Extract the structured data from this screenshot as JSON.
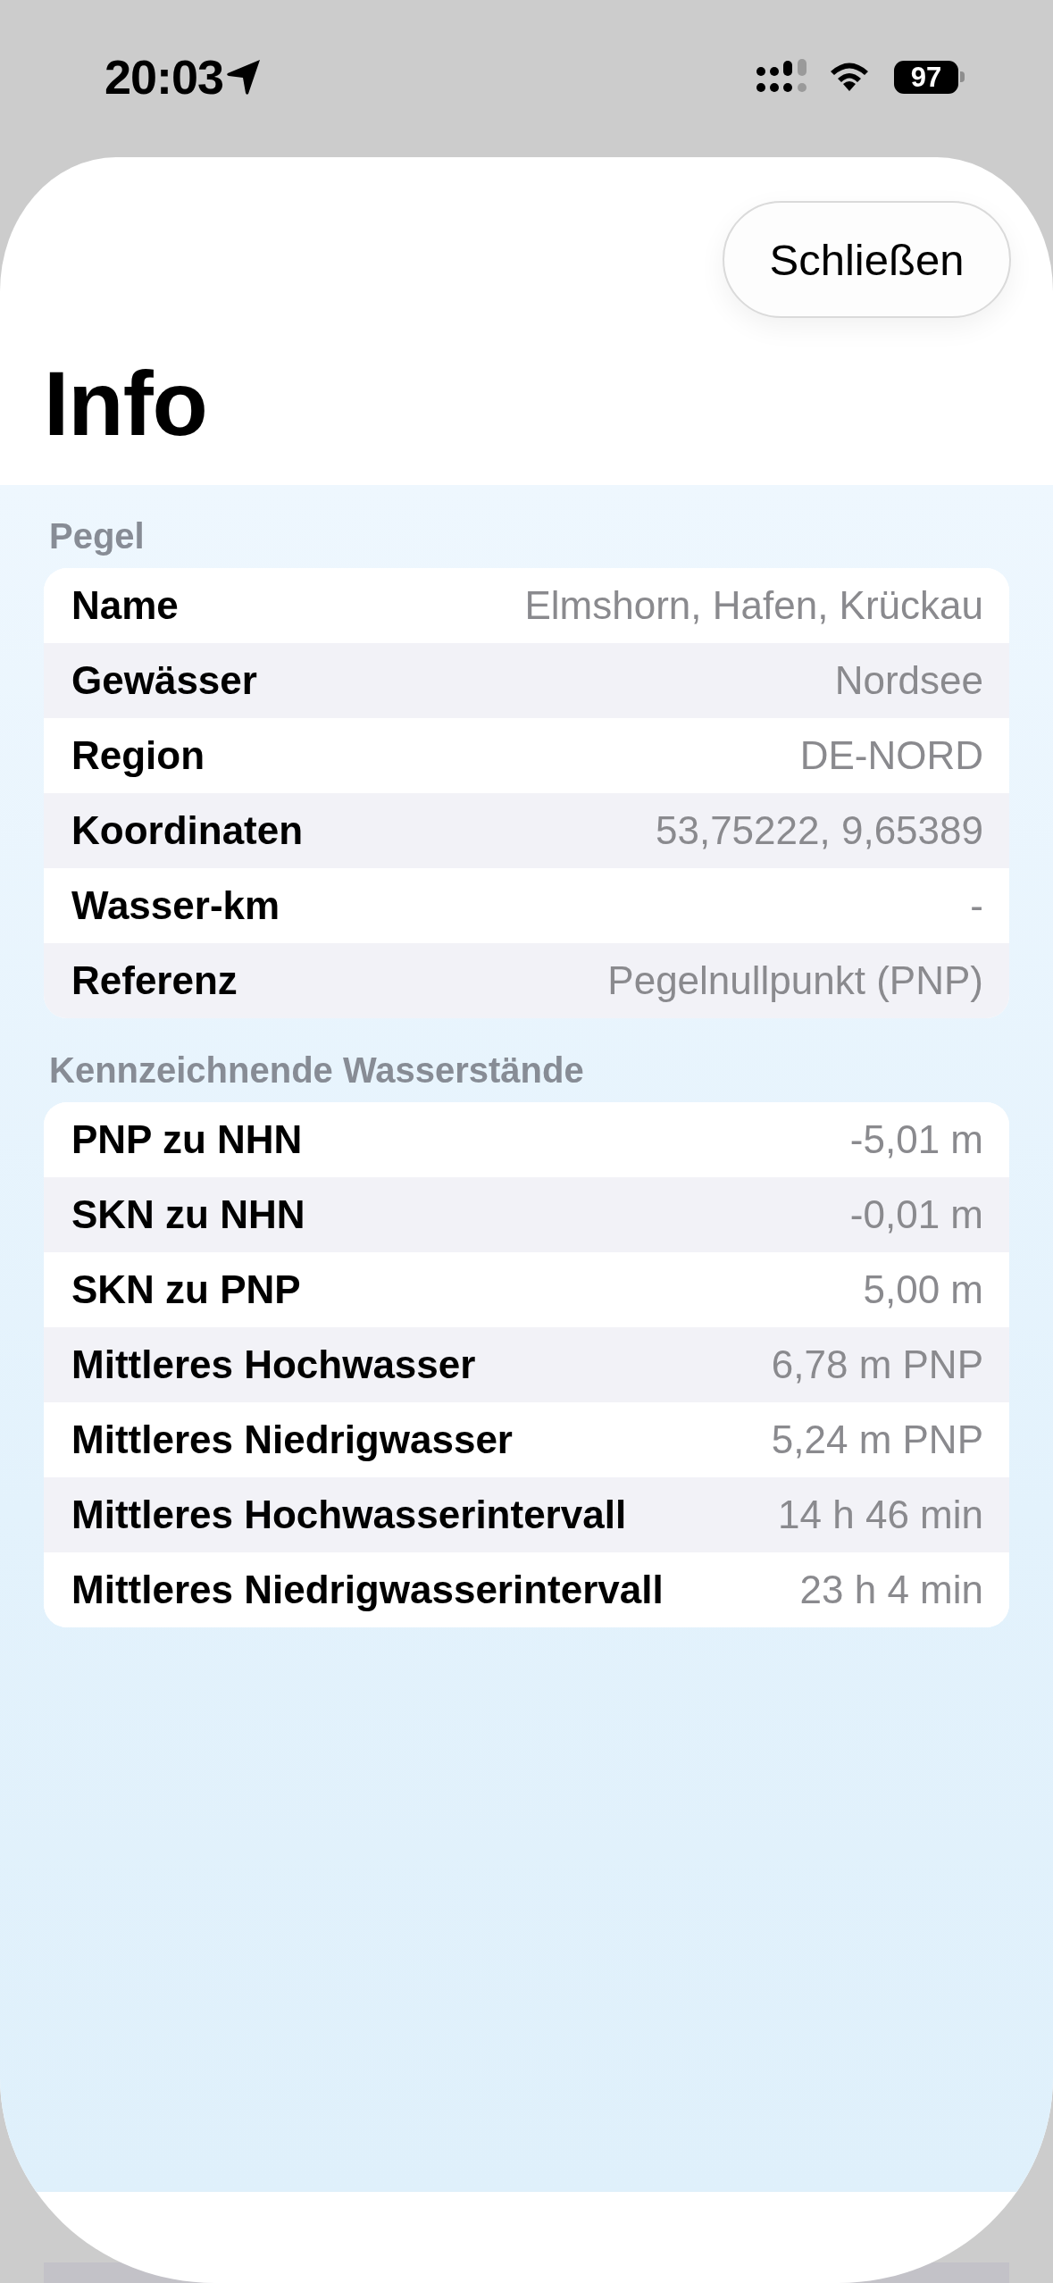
{
  "status_bar": {
    "time": "20:03",
    "battery": "97"
  },
  "header": {
    "close_button": "Schließen",
    "title": "Info"
  },
  "sections": [
    {
      "title": "Pegel",
      "rows": [
        {
          "label": "Name",
          "value": "Elmshorn, Hafen, Krückau"
        },
        {
          "label": "Gewässer",
          "value": "Nordsee"
        },
        {
          "label": "Region",
          "value": "DE-NORD"
        },
        {
          "label": "Koordinaten",
          "value": "53,75222, 9,65389"
        },
        {
          "label": "Wasser-km",
          "value": "-"
        },
        {
          "label": "Referenz",
          "value": "Pegelnullpunkt (PNP)"
        }
      ]
    },
    {
      "title": "Kennzeichnende Wasserstände",
      "rows": [
        {
          "label": "PNP zu NHN",
          "value": "-5,01 m"
        },
        {
          "label": "SKN zu NHN",
          "value": "-0,01 m"
        },
        {
          "label": "SKN zu PNP",
          "value": "5,00 m"
        },
        {
          "label": "Mittleres Hochwasser",
          "value": "6,78 m PNP"
        },
        {
          "label": "Mittleres Niedrigwasser",
          "value": "5,24 m PNP"
        },
        {
          "label": "Mittleres Hochwasserintervall",
          "value": "14 h 46 min"
        },
        {
          "label": "Mittleres Niedrigwasserintervall",
          "value": "23 h 4 min"
        }
      ]
    }
  ]
}
